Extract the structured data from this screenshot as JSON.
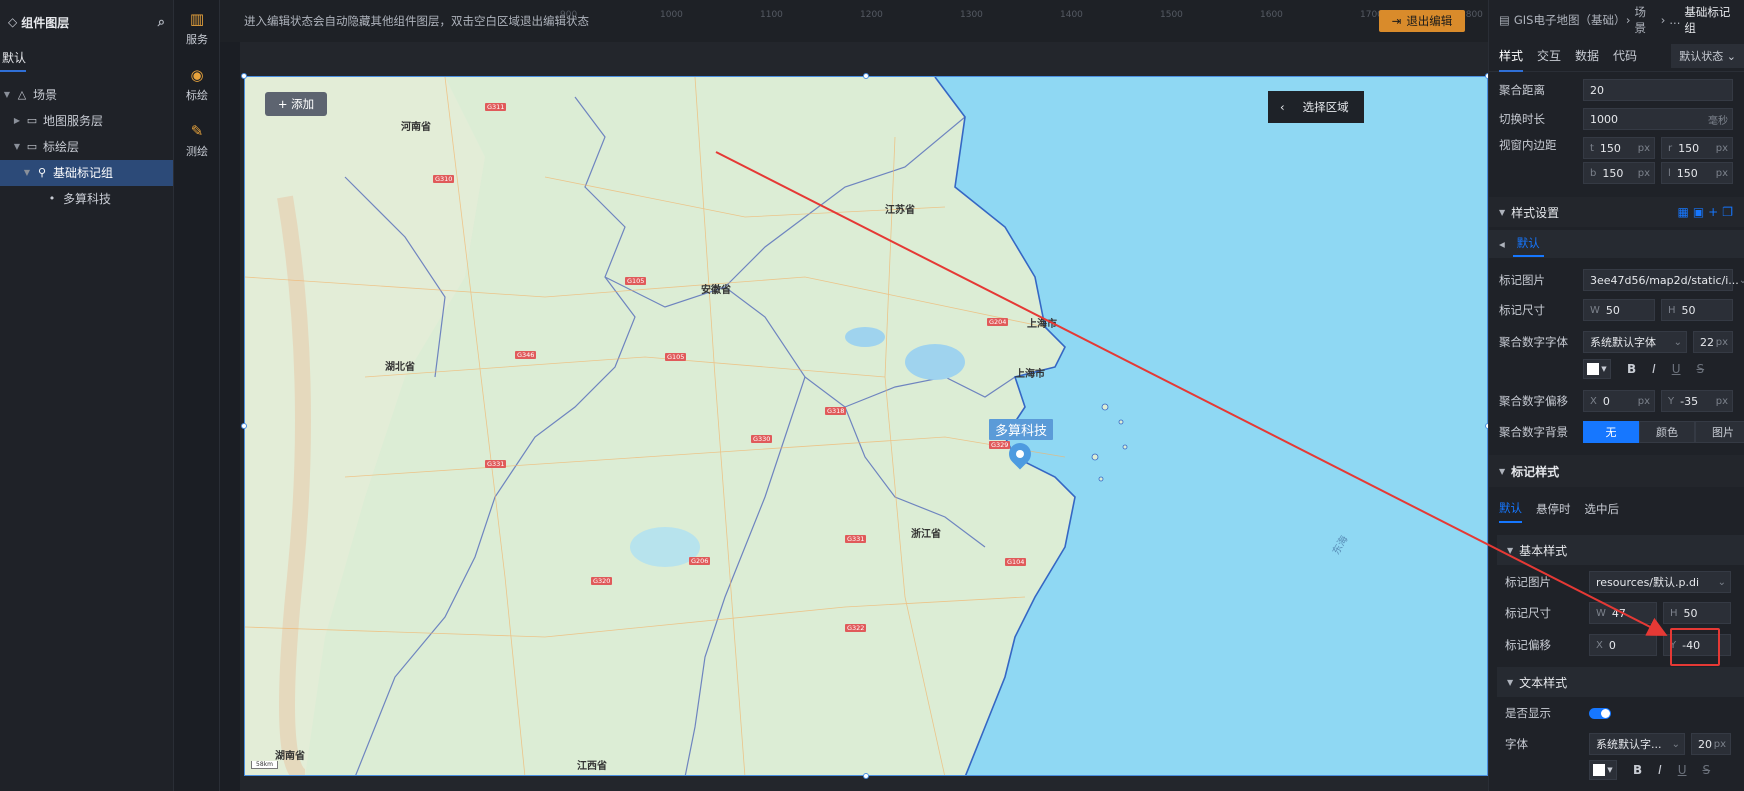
{
  "left_panel": {
    "title": "组件图层",
    "tab": "默认",
    "tree": [
      {
        "label": "场景",
        "depth": 0,
        "caret": "▼",
        "icon": "scene-icon"
      },
      {
        "label": "地图服务层",
        "depth": 1,
        "caret": "▶",
        "icon": "folder-icon"
      },
      {
        "label": "标绘层",
        "depth": 1,
        "caret": "▼",
        "icon": "folder-icon"
      },
      {
        "label": "基础标记组",
        "depth": 2,
        "caret": "▼",
        "icon": "marker-group-icon",
        "selected": true
      },
      {
        "label": "多算科技",
        "depth": 3,
        "caret": "",
        "icon": "dot-icon"
      }
    ]
  },
  "icon_bar": {
    "items": [
      {
        "label": "服务",
        "icon": "map-icon"
      },
      {
        "label": "标绘",
        "icon": "pin-icon"
      },
      {
        "label": "测绘",
        "icon": "measure-icon"
      }
    ]
  },
  "canvas": {
    "edit_message": "进入编辑状态会自动隐藏其他组件图层，双击空白区域退出编辑状态",
    "exit_button": "退出编辑",
    "add_button": "+ 添加",
    "select_area": "选择区域",
    "poi_label": "多算科技",
    "scale_label": "58km",
    "ruler_ticks": [
      "900",
      "1000",
      "1100",
      "1200",
      "1300",
      "1400",
      "1500",
      "1600",
      "1700",
      "1800"
    ]
  },
  "map_labels": [
    {
      "text": "河南省"
    },
    {
      "text": "江苏省"
    },
    {
      "text": "安徽省"
    },
    {
      "text": "湖北省"
    },
    {
      "text": "上海市"
    },
    {
      "text": "上海市"
    },
    {
      "text": "浙江省"
    },
    {
      "text": "湖南省"
    },
    {
      "text": "江西省"
    },
    {
      "text": "东海"
    }
  ],
  "right_panel": {
    "breadcrumb": [
      "GIS电子地图（基础）",
      "场景",
      "..."
    ],
    "breadcrumb_current": "基础标记组",
    "tabs": [
      "样式",
      "交互",
      "数据",
      "代码"
    ],
    "state_dropdown": "默认状态",
    "cluster_distance": {
      "label": "聚合距离",
      "value": "20"
    },
    "switch_duration": {
      "label": "切换时长",
      "value": "1000",
      "unit": "毫秒"
    },
    "viewport_padding": {
      "label": "视窗内边距",
      "t": "150",
      "r": "150",
      "b": "150",
      "l": "150",
      "unit": "px"
    },
    "style_settings": {
      "label": "样式设置",
      "default_tab": "默认"
    },
    "marker_image": {
      "label": "标记图片",
      "value": "3ee47d56/map2d/static/i..."
    },
    "marker_size": {
      "label": "标记尺寸",
      "w": "50",
      "h": "50"
    },
    "cluster_font": {
      "label": "聚合数字字体",
      "value": "系统默认字体",
      "size": "22",
      "unit": "px"
    },
    "cluster_offset": {
      "label": "聚合数字偏移",
      "x": "0",
      "y": "-35",
      "unit": "px"
    },
    "cluster_bg": {
      "label": "聚合数字背景",
      "options": [
        "无",
        "颜色",
        "图片"
      ],
      "selected": "无"
    },
    "marker_style": {
      "label": "标记样式",
      "tabs": [
        "默认",
        "悬停时",
        "选中后"
      ]
    },
    "basic_style": {
      "label": "基本样式"
    },
    "basic_marker_image": {
      "label": "标记图片",
      "value": "resources/默认.p.di"
    },
    "basic_marker_size": {
      "label": "标记尺寸",
      "w": "47",
      "h": "50"
    },
    "basic_marker_offset": {
      "label": "标记偏移",
      "x": "0",
      "y": "-40"
    },
    "text_style": {
      "label": "文本样式"
    },
    "show": {
      "label": "是否显示",
      "value": true
    },
    "font": {
      "label": "字体",
      "value": "系统默认字...",
      "size": "20",
      "unit": "px"
    },
    "format_icons": [
      "B",
      "I",
      "U",
      "S"
    ]
  },
  "colors": {
    "accent": "#1677ff",
    "exit_button": "#d98b2b",
    "annotation": "#e53935",
    "poi": "#5b9bd8"
  }
}
